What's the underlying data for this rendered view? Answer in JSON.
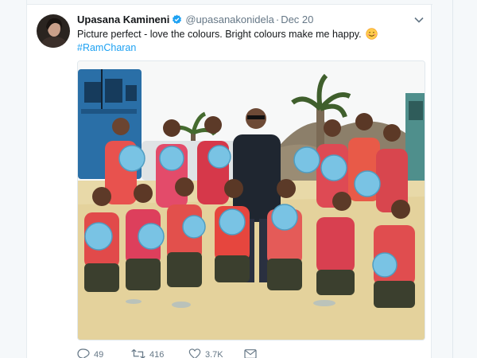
{
  "tweet": {
    "display_name": "Upasana Kamineni",
    "handle": "@upasanakonidela",
    "separator": "·",
    "date": "Dec 20",
    "text": "Picture perfect - love the colours. Bright colours make me happy.",
    "hashtag": "#RamCharan"
  },
  "actions": {
    "reply_count": "49",
    "retweet_count": "416",
    "like_count": "3.7K"
  },
  "icons": [
    "verified-badge-icon",
    "chevron-down-icon",
    "smiling-emoji-icon",
    "reply-icon",
    "retweet-icon",
    "like-icon",
    "message-icon"
  ],
  "colors": {
    "link": "#1da1f2",
    "name": "#14171a",
    "secondary": "#657786",
    "verified": "#1da1f2"
  }
}
